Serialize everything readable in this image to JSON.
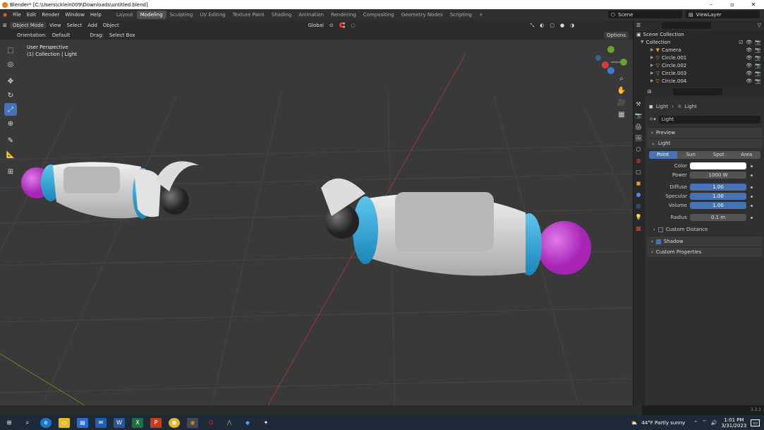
{
  "window": {
    "title": "Blender* [C:\\Users\\cklein009\\Downloads\\untitled.blend]",
    "minimize": "–",
    "maximize": "▫",
    "close": "✕"
  },
  "menu": [
    "File",
    "Edit",
    "Render",
    "Window",
    "Help"
  ],
  "workspaces": [
    "Layout",
    "Modeling",
    "Sculpting",
    "UV Editing",
    "Texture Paint",
    "Shading",
    "Animation",
    "Rendering",
    "Compositing",
    "Geometry Nodes",
    "Scripting",
    "+"
  ],
  "active_workspace": "Modeling",
  "scene": "Scene",
  "view_layer": "ViewLayer",
  "viewport_header": {
    "mode": "Object Mode",
    "view": "View",
    "select": "Select",
    "add": "Add",
    "object": "Object",
    "transform": "Global",
    "options": "Options"
  },
  "tool_settings": {
    "orientation_label": "Orientation:",
    "orientation_value": "Default",
    "drag_label": "Drag:",
    "drag_value": "Select Box"
  },
  "viewport": {
    "perspective": "User Perspective",
    "collection": "(1) Collection | Light"
  },
  "outliner": {
    "root": "Scene Collection",
    "collection": "Collection",
    "items": [
      "Camera",
      "Circle.001",
      "Circle.002",
      "Circle.003",
      "Circle.004"
    ]
  },
  "properties": {
    "breadcrumb_object": "Light",
    "breadcrumb_data": "Light",
    "data_name": "Light",
    "preview_label": "Preview",
    "light_panel": "Light",
    "light_types": [
      "Point",
      "Sun",
      "Spot",
      "Area"
    ],
    "active_type": "Point",
    "color_label": "Color",
    "power_label": "Power",
    "power_value": "1000 W",
    "diffuse_label": "Diffuse",
    "diffuse_value": "1.00",
    "specular_label": "Specular",
    "specular_value": "1.00",
    "volume_label": "Volume",
    "volume_value": "1.00",
    "radius_label": "Radius",
    "radius_value": "0.1 m",
    "custom_distance": "Custom Distance",
    "shadow": "Shadow",
    "custom_properties": "Custom Properties"
  },
  "version": "3.3.1",
  "taskbar": {
    "weather": "44°F  Partly sunny",
    "time": "1:01 PM",
    "date": "3/31/2023",
    "notif_count": "4"
  },
  "colors": {
    "accent": "#4772b3",
    "magenta": "#c63ad0",
    "cyan": "#2aa7d8",
    "body": "#d9d9d9"
  }
}
